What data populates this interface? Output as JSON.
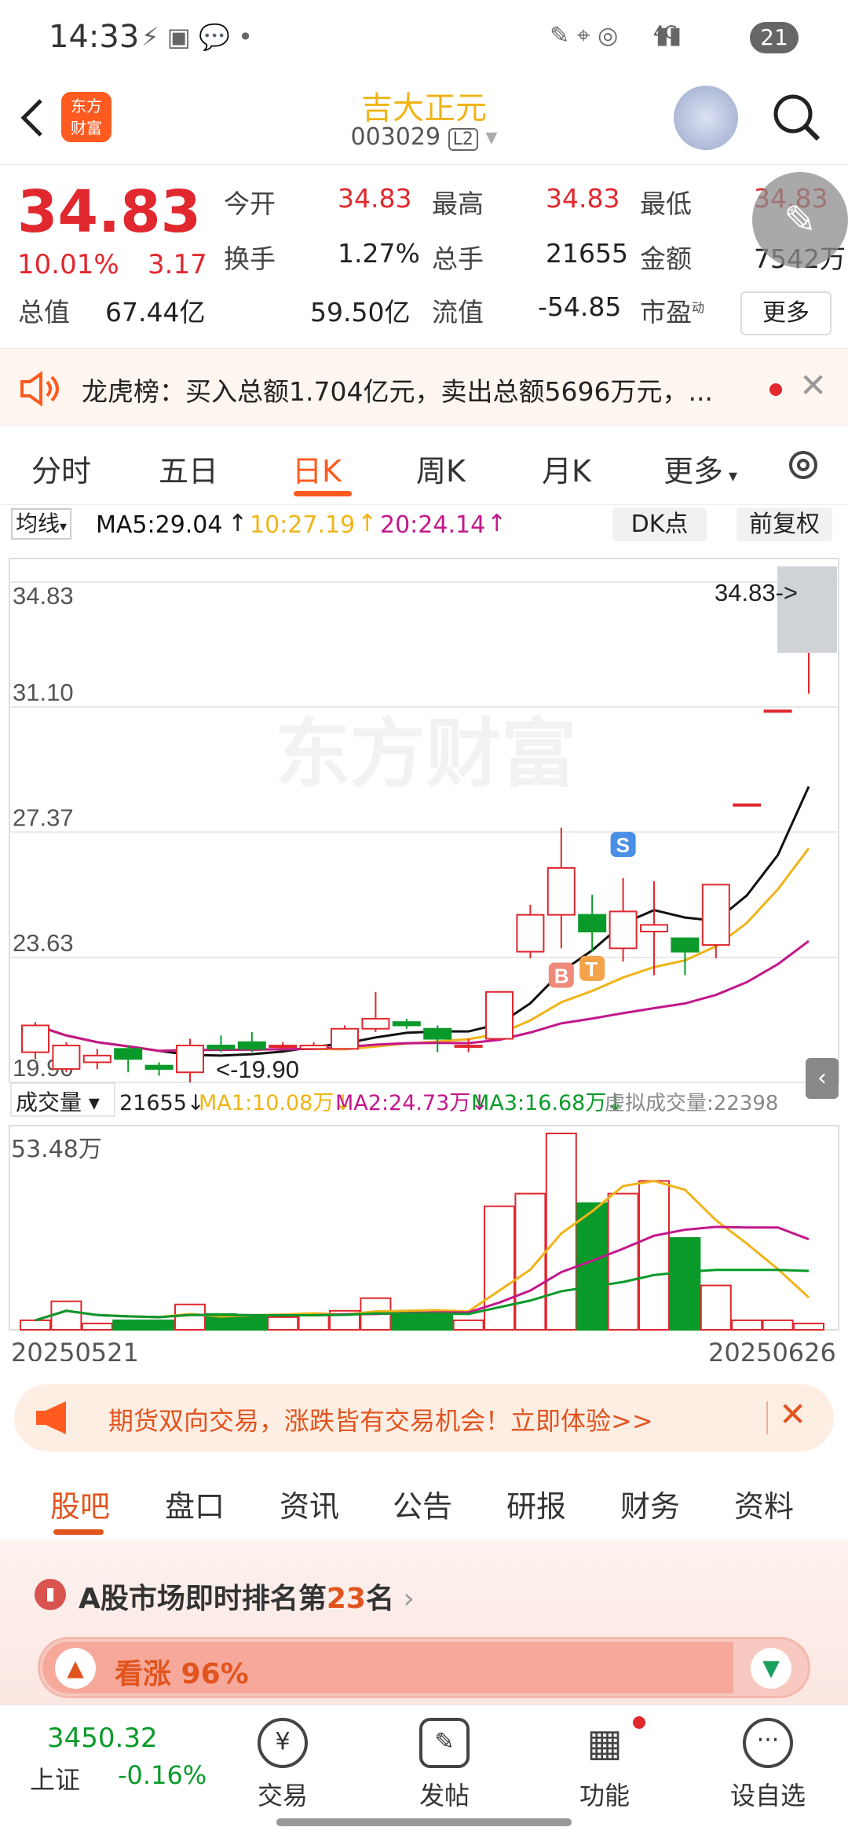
{
  "status": {
    "time": "14:33",
    "network": "4G",
    "battery": "21"
  },
  "header": {
    "brand_logo": "东方\n财富",
    "stock_name": "吉大正元",
    "stock_code": "003029",
    "level_badge": "L2"
  },
  "quote": {
    "price": "34.83",
    "change_pct": "10.01%",
    "change_amt": "3.17",
    "fields": [
      {
        "label": "今开",
        "value": "34.83",
        "color": "red"
      },
      {
        "label": "最高",
        "value": "34.83",
        "color": "red"
      },
      {
        "label": "最低",
        "value": "34.83",
        "color": "red"
      },
      {
        "label": "换手",
        "value": "1.27%",
        "color": "dark"
      },
      {
        "label": "总手",
        "value": "21655",
        "color": "dark"
      },
      {
        "label": "金额",
        "value": "7542万",
        "color": "dark"
      },
      {
        "label": "总值",
        "value": "67.44亿",
        "color": "dark"
      },
      {
        "label": "流值",
        "value": "59.50亿",
        "color": "dark"
      },
      {
        "label": "市盈",
        "value": "-54.85",
        "color": "dark",
        "sup": "动"
      }
    ],
    "more_button": "更多"
  },
  "notice": {
    "text": "龙虎榜：买入总额1.704亿元，卖出总额5696万元，..."
  },
  "kline_tabs": [
    "分时",
    "五日",
    "日K",
    "周K",
    "月K",
    "更多"
  ],
  "kline_active": "日K",
  "ma_bar": {
    "selector": "均线",
    "ma5": "MA5:29.04",
    "ma10": "10:27.19",
    "ma20": "20:24.14",
    "dk_button": "DK点",
    "adjust_button": "前复权"
  },
  "chart_labels": {
    "y_ticks": [
      "34.83",
      "31.10",
      "27.37",
      "23.63",
      "19.90"
    ],
    "last_price_tag": "34.83->",
    "low_tag": "<-19.90",
    "watermark": "东方财富",
    "markers": [
      "B",
      "T",
      "S"
    ]
  },
  "volume_bar": {
    "selector": "成交量",
    "vol": "21655",
    "ma1": "MA1:10.08万",
    "ma2": "MA2:24.73万",
    "ma3": "MA3:16.68万",
    "virtual": "虚拟成交量:22398",
    "max_label": "53.48万",
    "date_start": "20250521",
    "date_end": "20250626"
  },
  "chart_data": {
    "type": "candlestick",
    "ylim": [
      19.9,
      34.83
    ],
    "candles": [
      {
        "o": 20.8,
        "c": 21.6,
        "h": 21.7,
        "l": 20.6
      },
      {
        "o": 20.3,
        "c": 21.0,
        "h": 21.1,
        "l": 20.2
      },
      {
        "o": 20.5,
        "c": 20.7,
        "h": 20.9,
        "l": 20.3
      },
      {
        "o": 20.9,
        "c": 20.6,
        "h": 21.0,
        "l": 20.2
      },
      {
        "o": 20.4,
        "c": 20.3,
        "h": 20.5,
        "l": 20.1
      },
      {
        "o": 20.2,
        "c": 21.0,
        "h": 21.2,
        "l": 19.9
      },
      {
        "o": 21.0,
        "c": 20.9,
        "h": 21.3,
        "l": 20.8
      },
      {
        "o": 21.1,
        "c": 20.9,
        "h": 21.4,
        "l": 20.8
      },
      {
        "o": 21.0,
        "c": 21.0,
        "h": 21.1,
        "l": 20.9
      },
      {
        "o": 20.9,
        "c": 21.0,
        "h": 21.1,
        "l": 20.9
      },
      {
        "o": 20.9,
        "c": 21.5,
        "h": 21.6,
        "l": 20.9
      },
      {
        "o": 21.5,
        "c": 21.8,
        "h": 22.6,
        "l": 21.4
      },
      {
        "o": 21.7,
        "c": 21.6,
        "h": 21.8,
        "l": 21.5
      },
      {
        "o": 21.5,
        "c": 21.2,
        "h": 21.6,
        "l": 20.8
      },
      {
        "o": 21.0,
        "c": 21.0,
        "h": 21.2,
        "l": 20.8
      },
      {
        "o": 21.2,
        "c": 22.6,
        "h": 22.6,
        "l": 21.2
      },
      {
        "o": 23.8,
        "c": 24.9,
        "h": 25.2,
        "l": 23.6
      },
      {
        "o": 24.9,
        "c": 26.3,
        "h": 27.5,
        "l": 23.9
      },
      {
        "o": 24.9,
        "c": 24.4,
        "h": 25.5,
        "l": 23.8
      },
      {
        "o": 23.9,
        "c": 25.0,
        "h": 26.0,
        "l": 23.5
      },
      {
        "o": 24.4,
        "c": 24.6,
        "h": 25.9,
        "l": 23.1
      },
      {
        "o": 24.2,
        "c": 23.8,
        "h": 24.2,
        "l": 23.1
      },
      {
        "o": 24.0,
        "c": 25.8,
        "h": 25.8,
        "l": 23.6
      },
      {
        "o": 28.2,
        "c": 28.2,
        "h": 28.2,
        "l": 28.2
      },
      {
        "o": 31.0,
        "c": 31.0,
        "h": 31.0,
        "l": 31.0
      },
      {
        "o": 34.83,
        "c": 34.83,
        "h": 34.83,
        "l": 31.5
      }
    ],
    "volume": [
      3,
      9,
      2,
      3,
      3,
      8,
      5,
      4,
      4,
      5,
      6,
      10,
      5,
      5,
      3,
      39,
      43,
      62,
      40,
      43,
      47,
      29,
      14,
      3,
      3,
      2
    ],
    "series": [
      {
        "name": "MA5",
        "color": "#111111"
      },
      {
        "name": "MA10",
        "color": "#f0b416"
      },
      {
        "name": "MA20",
        "color": "#c2188c"
      }
    ]
  },
  "promo": {
    "text": "期货双向交易，涨跌皆有交易机会！立即体验>>"
  },
  "bottom_tabs": [
    "股吧",
    "盘口",
    "资讯",
    "公告",
    "研报",
    "财务",
    "资料"
  ],
  "rank": {
    "prefix": "A股市场即时排名第",
    "number": "23",
    "suffix": "名",
    "sentiment": "看涨 96%"
  },
  "nav": {
    "index_value": "3450.32",
    "index_name": "上证",
    "index_change": "-0.16%",
    "items": [
      "交易",
      "发帖",
      "功能",
      "设自选"
    ]
  },
  "colors": {
    "up": "#e0282e",
    "down": "#0a9a2a",
    "accent": "#ff5a1f"
  }
}
